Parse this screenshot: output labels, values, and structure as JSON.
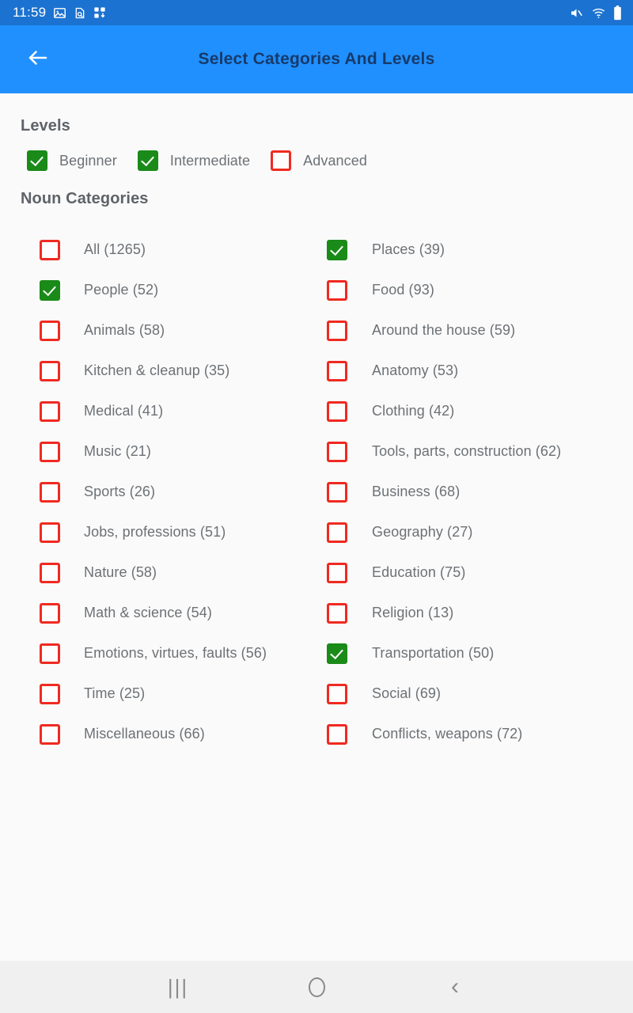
{
  "status_bar": {
    "time": "11:59",
    "left_icons": [
      "image-icon",
      "document-search-icon",
      "app-download-icon"
    ],
    "right_icons": [
      "mute-icon",
      "wifi-icon",
      "battery-icon"
    ],
    "background_color": "#1b72d0"
  },
  "app_bar": {
    "title": "Select Categories And Levels",
    "back_icon": "back-arrow-icon",
    "background_color": "#2090fe",
    "title_color": "#173a6b"
  },
  "colors": {
    "checkbox_checked": "#1a8a19",
    "checkbox_unchecked_border": "#ef2a21",
    "label_text": "#6d7175",
    "section_title": "#5f6368",
    "page_background": "#fafafa",
    "nav_bar_background": "#f0f0f0"
  },
  "levels_section": {
    "title": "Levels",
    "items": [
      {
        "label": "Beginner",
        "checked": true
      },
      {
        "label": "Intermediate",
        "checked": true
      },
      {
        "label": "Advanced",
        "checked": false
      }
    ]
  },
  "categories_section": {
    "title": "Noun Categories",
    "left_column": [
      {
        "label": "All (1265)",
        "checked": false
      },
      {
        "label": "People (52)",
        "checked": true
      },
      {
        "label": "Animals (58)",
        "checked": false
      },
      {
        "label": "Kitchen & cleanup (35)",
        "checked": false
      },
      {
        "label": "Medical (41)",
        "checked": false
      },
      {
        "label": "Music (21)",
        "checked": false
      },
      {
        "label": "Sports (26)",
        "checked": false
      },
      {
        "label": "Jobs, professions (51)",
        "checked": false
      },
      {
        "label": "Nature (58)",
        "checked": false
      },
      {
        "label": "Math & science (54)",
        "checked": false
      },
      {
        "label": "Emotions, virtues, faults (56)",
        "checked": false
      },
      {
        "label": "Time (25)",
        "checked": false
      },
      {
        "label": "Miscellaneous (66)",
        "checked": false
      }
    ],
    "right_column": [
      {
        "label": "Places (39)",
        "checked": true
      },
      {
        "label": "Food (93)",
        "checked": false
      },
      {
        "label": "Around the house (59)",
        "checked": false
      },
      {
        "label": "Anatomy (53)",
        "checked": false
      },
      {
        "label": "Clothing (42)",
        "checked": false
      },
      {
        "label": "Tools, parts, construction (62)",
        "checked": false
      },
      {
        "label": "Business (68)",
        "checked": false
      },
      {
        "label": "Geography (27)",
        "checked": false
      },
      {
        "label": "Education (75)",
        "checked": false
      },
      {
        "label": "Religion (13)",
        "checked": false
      },
      {
        "label": "Transportation (50)",
        "checked": true
      },
      {
        "label": "Social (69)",
        "checked": false
      },
      {
        "label": "Conflicts, weapons (72)",
        "checked": false
      }
    ]
  },
  "nav_bar": {
    "recents_label": "|||",
    "home_icon": "home-circle-icon",
    "back_label": "‹"
  }
}
